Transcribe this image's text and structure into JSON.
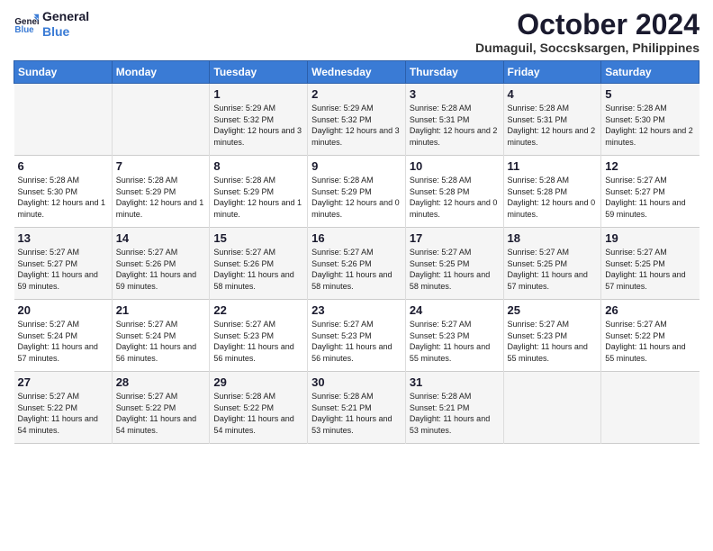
{
  "logo": {
    "line1": "General",
    "line2": "Blue"
  },
  "title": "October 2024",
  "location": "Dumaguil, Soccsksargen, Philippines",
  "weekdays": [
    "Sunday",
    "Monday",
    "Tuesday",
    "Wednesday",
    "Thursday",
    "Friday",
    "Saturday"
  ],
  "weeks": [
    [
      {
        "day": "",
        "info": ""
      },
      {
        "day": "",
        "info": ""
      },
      {
        "day": "1",
        "info": "Sunrise: 5:29 AM\nSunset: 5:32 PM\nDaylight: 12 hours and 3 minutes."
      },
      {
        "day": "2",
        "info": "Sunrise: 5:29 AM\nSunset: 5:32 PM\nDaylight: 12 hours and 3 minutes."
      },
      {
        "day": "3",
        "info": "Sunrise: 5:28 AM\nSunset: 5:31 PM\nDaylight: 12 hours and 2 minutes."
      },
      {
        "day": "4",
        "info": "Sunrise: 5:28 AM\nSunset: 5:31 PM\nDaylight: 12 hours and 2 minutes."
      },
      {
        "day": "5",
        "info": "Sunrise: 5:28 AM\nSunset: 5:30 PM\nDaylight: 12 hours and 2 minutes."
      }
    ],
    [
      {
        "day": "6",
        "info": "Sunrise: 5:28 AM\nSunset: 5:30 PM\nDaylight: 12 hours and 1 minute."
      },
      {
        "day": "7",
        "info": "Sunrise: 5:28 AM\nSunset: 5:29 PM\nDaylight: 12 hours and 1 minute."
      },
      {
        "day": "8",
        "info": "Sunrise: 5:28 AM\nSunset: 5:29 PM\nDaylight: 12 hours and 1 minute."
      },
      {
        "day": "9",
        "info": "Sunrise: 5:28 AM\nSunset: 5:29 PM\nDaylight: 12 hours and 0 minutes."
      },
      {
        "day": "10",
        "info": "Sunrise: 5:28 AM\nSunset: 5:28 PM\nDaylight: 12 hours and 0 minutes."
      },
      {
        "day": "11",
        "info": "Sunrise: 5:28 AM\nSunset: 5:28 PM\nDaylight: 12 hours and 0 minutes."
      },
      {
        "day": "12",
        "info": "Sunrise: 5:27 AM\nSunset: 5:27 PM\nDaylight: 11 hours and 59 minutes."
      }
    ],
    [
      {
        "day": "13",
        "info": "Sunrise: 5:27 AM\nSunset: 5:27 PM\nDaylight: 11 hours and 59 minutes."
      },
      {
        "day": "14",
        "info": "Sunrise: 5:27 AM\nSunset: 5:26 PM\nDaylight: 11 hours and 59 minutes."
      },
      {
        "day": "15",
        "info": "Sunrise: 5:27 AM\nSunset: 5:26 PM\nDaylight: 11 hours and 58 minutes."
      },
      {
        "day": "16",
        "info": "Sunrise: 5:27 AM\nSunset: 5:26 PM\nDaylight: 11 hours and 58 minutes."
      },
      {
        "day": "17",
        "info": "Sunrise: 5:27 AM\nSunset: 5:25 PM\nDaylight: 11 hours and 58 minutes."
      },
      {
        "day": "18",
        "info": "Sunrise: 5:27 AM\nSunset: 5:25 PM\nDaylight: 11 hours and 57 minutes."
      },
      {
        "day": "19",
        "info": "Sunrise: 5:27 AM\nSunset: 5:25 PM\nDaylight: 11 hours and 57 minutes."
      }
    ],
    [
      {
        "day": "20",
        "info": "Sunrise: 5:27 AM\nSunset: 5:24 PM\nDaylight: 11 hours and 57 minutes."
      },
      {
        "day": "21",
        "info": "Sunrise: 5:27 AM\nSunset: 5:24 PM\nDaylight: 11 hours and 56 minutes."
      },
      {
        "day": "22",
        "info": "Sunrise: 5:27 AM\nSunset: 5:23 PM\nDaylight: 11 hours and 56 minutes."
      },
      {
        "day": "23",
        "info": "Sunrise: 5:27 AM\nSunset: 5:23 PM\nDaylight: 11 hours and 56 minutes."
      },
      {
        "day": "24",
        "info": "Sunrise: 5:27 AM\nSunset: 5:23 PM\nDaylight: 11 hours and 55 minutes."
      },
      {
        "day": "25",
        "info": "Sunrise: 5:27 AM\nSunset: 5:23 PM\nDaylight: 11 hours and 55 minutes."
      },
      {
        "day": "26",
        "info": "Sunrise: 5:27 AM\nSunset: 5:22 PM\nDaylight: 11 hours and 55 minutes."
      }
    ],
    [
      {
        "day": "27",
        "info": "Sunrise: 5:27 AM\nSunset: 5:22 PM\nDaylight: 11 hours and 54 minutes."
      },
      {
        "day": "28",
        "info": "Sunrise: 5:27 AM\nSunset: 5:22 PM\nDaylight: 11 hours and 54 minutes."
      },
      {
        "day": "29",
        "info": "Sunrise: 5:28 AM\nSunset: 5:22 PM\nDaylight: 11 hours and 54 minutes."
      },
      {
        "day": "30",
        "info": "Sunrise: 5:28 AM\nSunset: 5:21 PM\nDaylight: 11 hours and 53 minutes."
      },
      {
        "day": "31",
        "info": "Sunrise: 5:28 AM\nSunset: 5:21 PM\nDaylight: 11 hours and 53 minutes."
      },
      {
        "day": "",
        "info": ""
      },
      {
        "day": "",
        "info": ""
      }
    ]
  ]
}
